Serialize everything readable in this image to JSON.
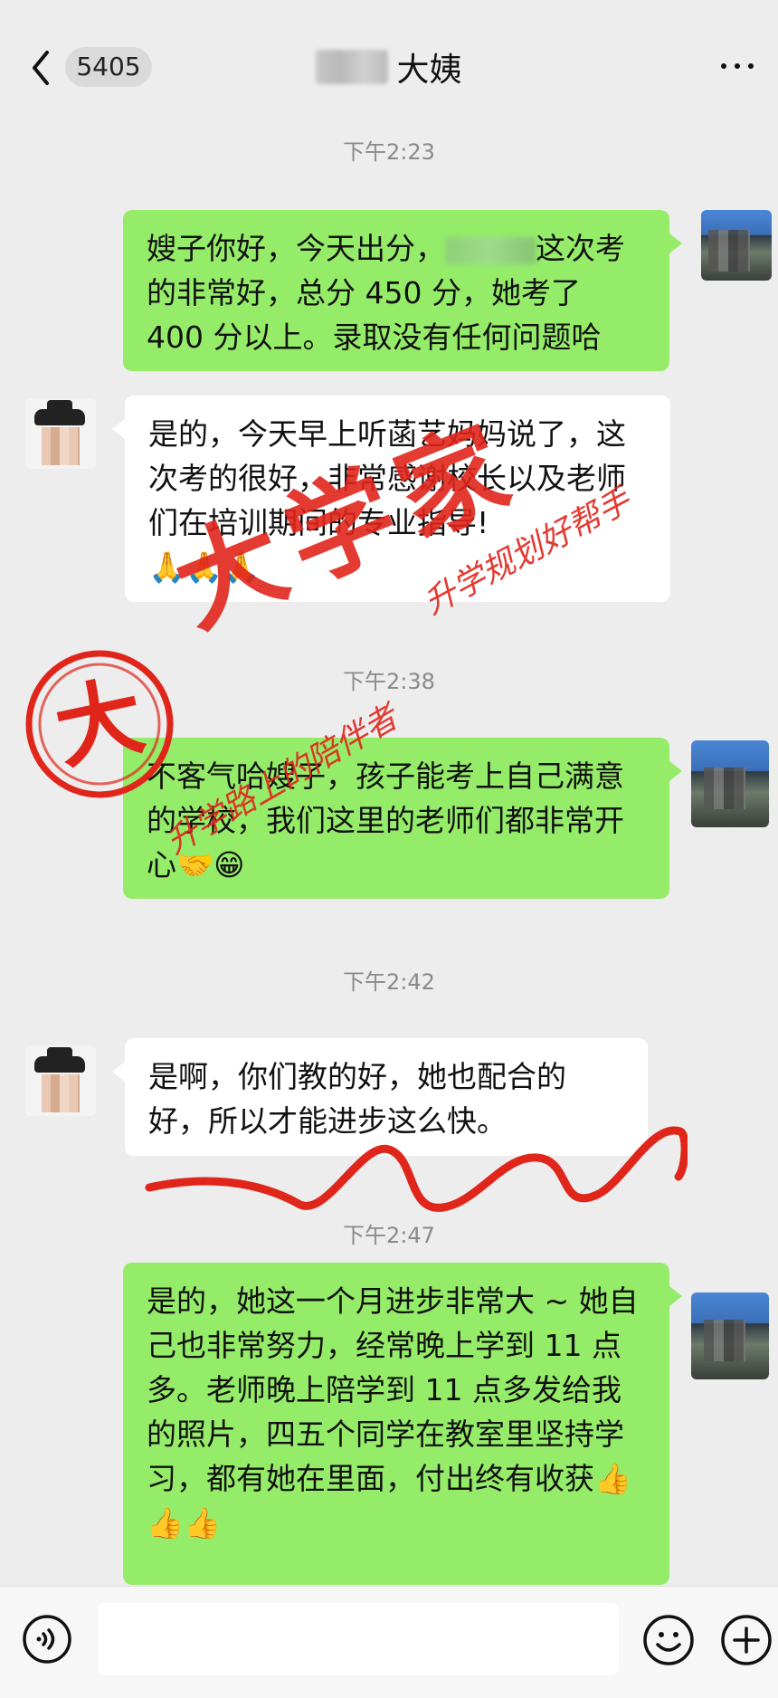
{
  "header": {
    "unread_count": "5405",
    "title": "大姨"
  },
  "messages": [
    {
      "time": "下午2:23"
    },
    {
      "side": "self",
      "text_before": "嫂子你好，今天出分，",
      "text_after": "这次考的非常好，总分 450 分，她考了 400 分以上。录取没有任何问题哈"
    },
    {
      "side": "other",
      "text": "是的，今天早上听菡艺妈妈说了，这次考的很好，非常感谢校长以及老师们在培训期间的专业指导!",
      "emoji": "🙏🙏🙏"
    },
    {
      "time": "下午2:38"
    },
    {
      "side": "self",
      "text": "不客气哈嫂子，孩子能考上自己满意的学校，我们这里的老师们都非常开心",
      "emoji": "🤝😁"
    },
    {
      "time": "下午2:42"
    },
    {
      "side": "other",
      "text": "是啊，你们教的好，她也配合的好，所以才能进步这么快。"
    },
    {
      "time": "下午2:47"
    },
    {
      "side": "self",
      "text": "是的，她这一个月进步非常大 ~ 她自己也非常努力，经常晚上学到 11 点多。老师晚上陪学到 11 点多发给我的照片，四五个同学在教室里坚持学习，都有她在里面，付出终有收获",
      "emoji": "👍👍👍"
    }
  ],
  "watermark": {
    "stamp_char": "大",
    "big_text": "大学家",
    "slogan_1": "升学规划好帮手",
    "slogan_2": "升学路上的陪伴者"
  },
  "colors": {
    "background": "#ededed",
    "self_bubble": "#95ec69",
    "other_bubble": "#ffffff",
    "watermark_red": "#e0251b"
  },
  "icons": {
    "back": "chevron-left-icon",
    "more": "more-dots-icon",
    "voice": "voice-icon",
    "emoji": "emoji-icon",
    "plus": "plus-icon"
  }
}
